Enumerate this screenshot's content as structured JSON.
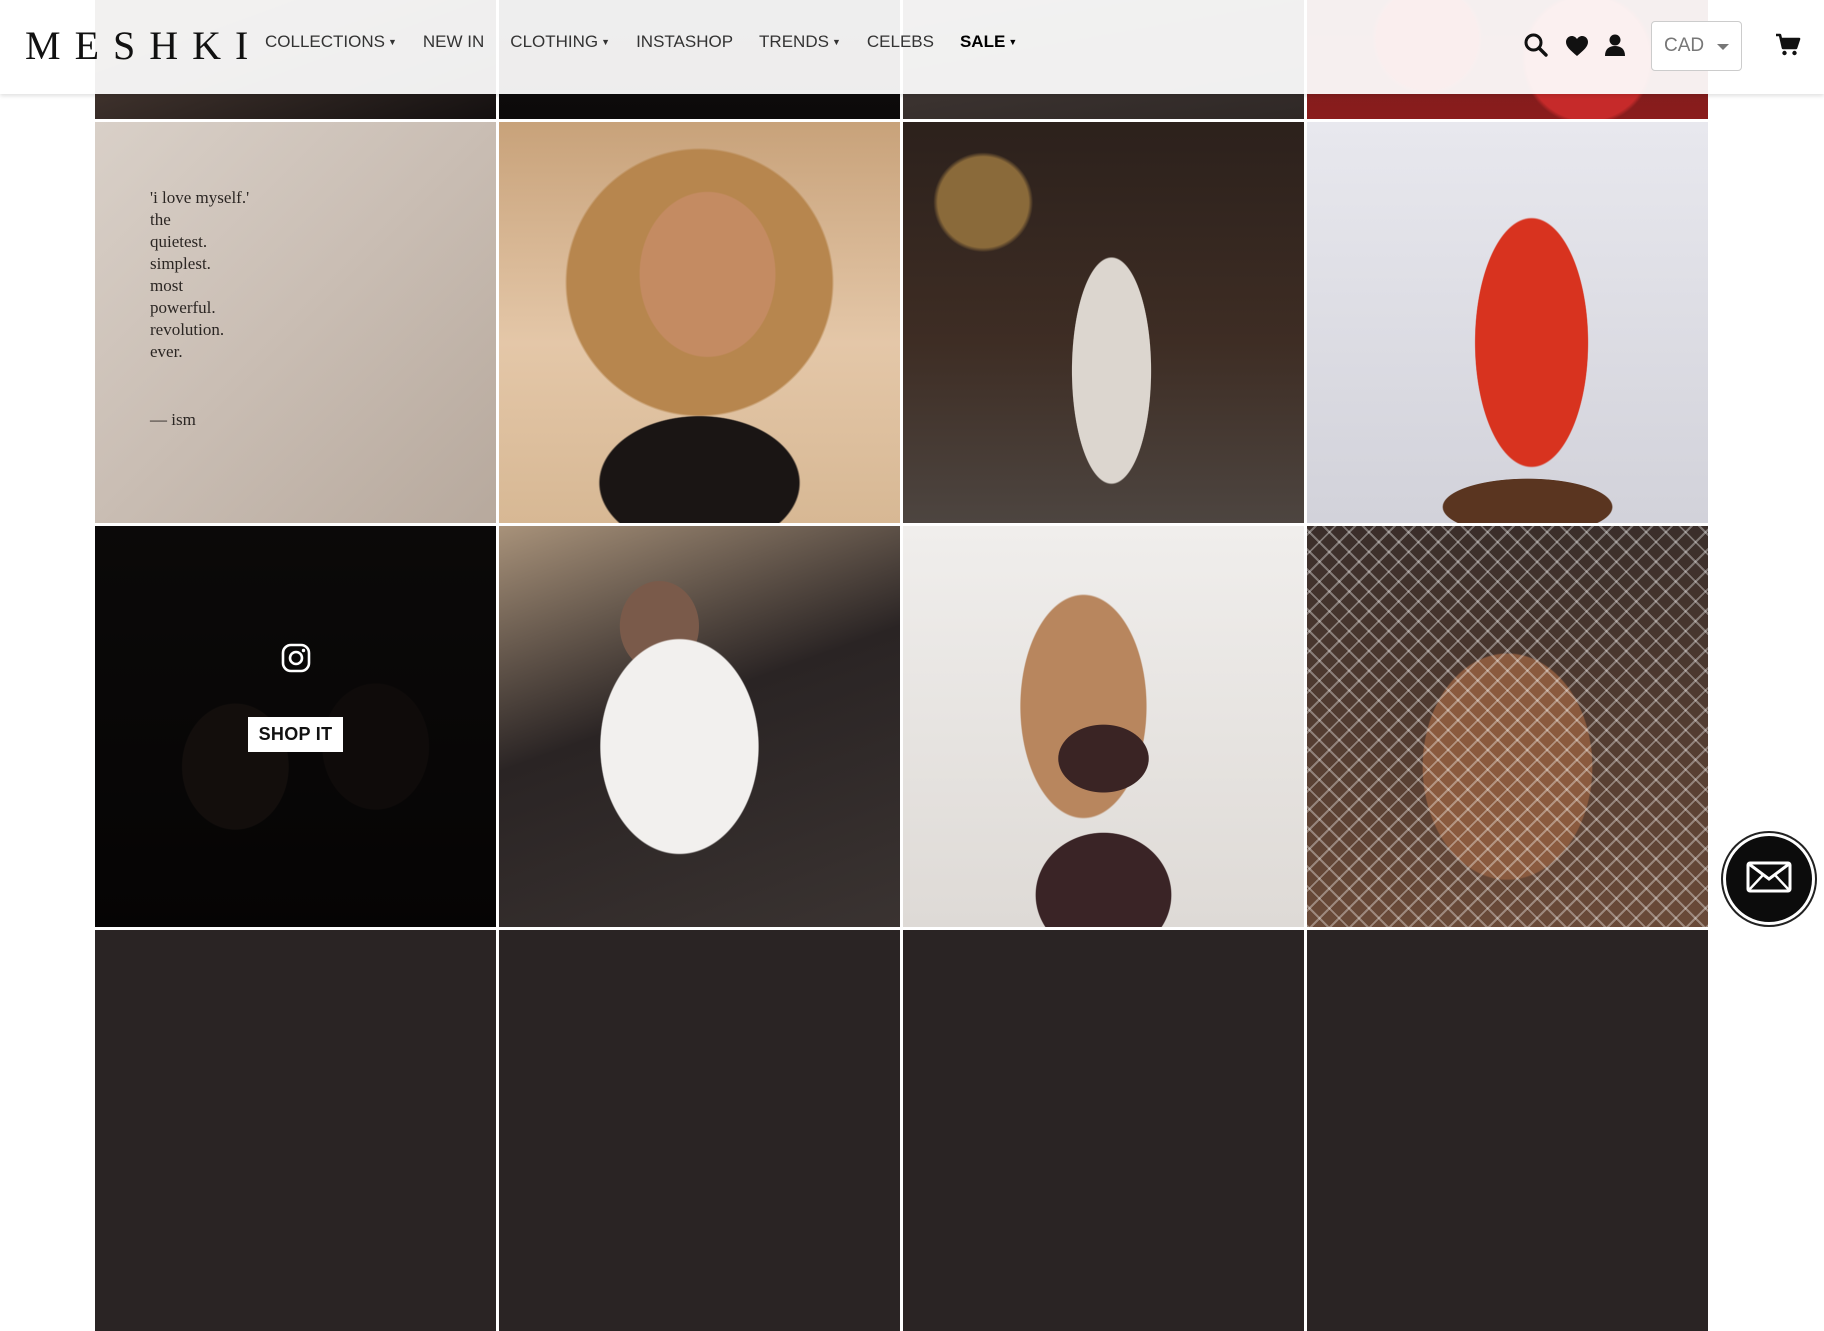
{
  "brand": {
    "logo_text": "MESHKI"
  },
  "nav": {
    "items": [
      {
        "label": "COLLECTIONS",
        "dropdown": true
      },
      {
        "label": "NEW IN",
        "dropdown": false
      },
      {
        "label": "CLOTHING",
        "dropdown": true
      },
      {
        "label": "INSTASHOP",
        "dropdown": false
      },
      {
        "label": "TRENDS",
        "dropdown": true
      },
      {
        "label": "CELEBS",
        "dropdown": false
      },
      {
        "label": "SALE",
        "dropdown": true,
        "emphasis": true
      }
    ]
  },
  "header_icons": {
    "search": "search-icon",
    "wishlist": "heart-icon",
    "account": "user-icon",
    "cart": "cart-icon"
  },
  "currency": {
    "selected": "CAD"
  },
  "quote_tile": {
    "text": "'i love myself.'\nthe\nquietest.\nsimplest.\nmost\npowerful.\nrevolution.\never.",
    "author": "— ism"
  },
  "hover_tile": {
    "button_label": "SHOP IT",
    "icon": "instagram-icon"
  },
  "chat": {
    "icon": "envelope-icon"
  },
  "colors": {
    "header_bg": "#ffffff",
    "text": "#333333",
    "chat_bg": "#0c0c0c"
  }
}
